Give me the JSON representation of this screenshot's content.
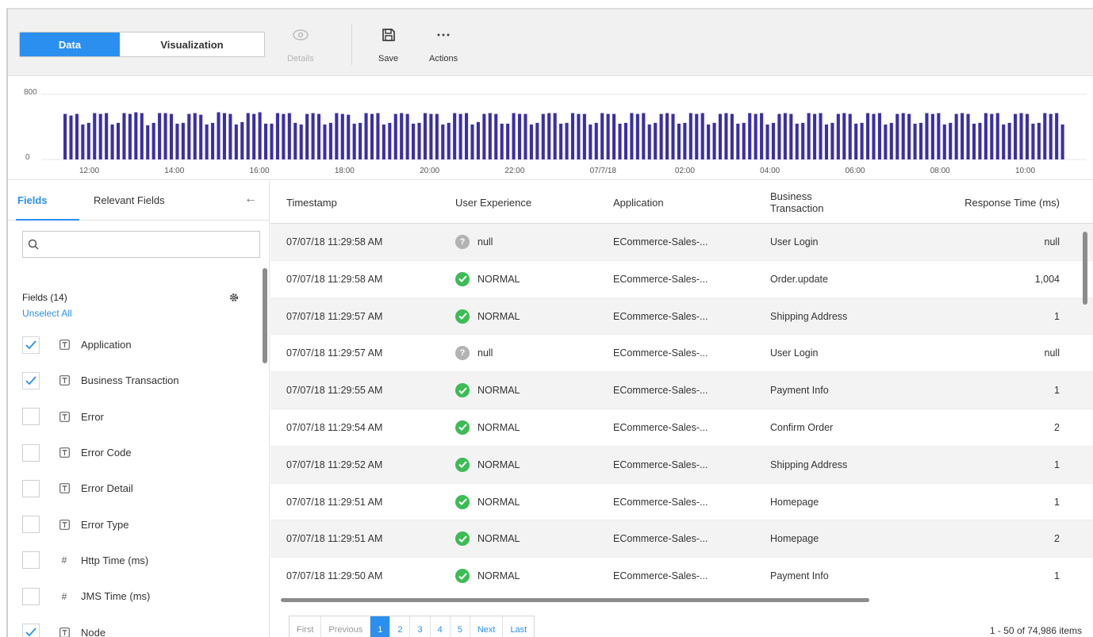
{
  "toolbar": {
    "tab_data": "Data",
    "tab_visualization": "Visualization",
    "details_label": "Details",
    "save_label": "Save",
    "actions_label": "Actions",
    "accent_color": "#2b8ff0"
  },
  "histogram": {
    "y_max_label": "800",
    "y_min_label": "0",
    "x_labels": [
      "12:00",
      "14:00",
      "16:00",
      "18:00",
      "20:00",
      "22:00",
      "07/7/18",
      "02:00",
      "04:00",
      "06:00",
      "08:00",
      "10:00"
    ],
    "bar_color": "#3a2fa8"
  },
  "chart_data": {
    "type": "bar",
    "ylim": [
      0,
      800
    ],
    "grid": true,
    "values": [
      560,
      540,
      560,
      430,
      450,
      570,
      560,
      570,
      430,
      450,
      570,
      560,
      580,
      570,
      420,
      450,
      570,
      570,
      560,
      440,
      450,
      560,
      570,
      550,
      430,
      450,
      580,
      570,
      560,
      430,
      460,
      570,
      560,
      580,
      440,
      440,
      570,
      560,
      570,
      450,
      430,
      560,
      570,
      560,
      430,
      450,
      570,
      560,
      550,
      440,
      450,
      570,
      560,
      570,
      430,
      450,
      560,
      570,
      560,
      440,
      450,
      570,
      560,
      560,
      430,
      450,
      570,
      560,
      570,
      430,
      460,
      560,
      570,
      560,
      440,
      440,
      570,
      560,
      560,
      430,
      450,
      560,
      570,
      570,
      440,
      450,
      570,
      560,
      560,
      430,
      450,
      570,
      560,
      560,
      440,
      450,
      570,
      560,
      570,
      430,
      450,
      560,
      570,
      560,
      440,
      450,
      570,
      560,
      570,
      430,
      450,
      560,
      570,
      560,
      440,
      450,
      570,
      560,
      570,
      430,
      450,
      560,
      570,
      560,
      440,
      450,
      570,
      560,
      570,
      430,
      450,
      560,
      570,
      560,
      440,
      450,
      570,
      560,
      570,
      430,
      450,
      560,
      570,
      560,
      440,
      450,
      570,
      560,
      570,
      430,
      450,
      560,
      570,
      560,
      440,
      450,
      570,
      560,
      570,
      430,
      450,
      560,
      570,
      560,
      440,
      450,
      570,
      560,
      570,
      430
    ]
  },
  "left_panel": {
    "tab_fields": "Fields",
    "tab_relevant": "Relevant Fields",
    "back_icon": "arrow-left-icon",
    "search_placeholder": "",
    "fields_count_label": "Fields (14)",
    "unselect_all": "Unselect All",
    "fields": [
      {
        "name": "Application",
        "type": "text",
        "checked": true
      },
      {
        "name": "Business Transaction",
        "type": "text",
        "checked": true
      },
      {
        "name": "Error",
        "type": "text",
        "checked": false
      },
      {
        "name": "Error Code",
        "type": "text",
        "checked": false
      },
      {
        "name": "Error Detail",
        "type": "text",
        "checked": false
      },
      {
        "name": "Error Type",
        "type": "text",
        "checked": false
      },
      {
        "name": "Http Time (ms)",
        "type": "number",
        "checked": false
      },
      {
        "name": "JMS Time (ms)",
        "type": "number",
        "checked": false
      },
      {
        "name": "Node",
        "type": "text",
        "checked": true
      }
    ]
  },
  "table": {
    "columns": [
      "Timestamp",
      "User Experience",
      "Application",
      "Business Transaction",
      "Response Time (ms)"
    ],
    "rows": [
      {
        "ts": "07/07/18 11:29:58 AM",
        "ux": "null",
        "ux_ok": false,
        "app": "ECommerce-Sales-...",
        "bt": "User Login",
        "rt": "null"
      },
      {
        "ts": "07/07/18 11:29:58 AM",
        "ux": "NORMAL",
        "ux_ok": true,
        "app": "ECommerce-Sales-...",
        "bt": "Order.update",
        "rt": "1,004"
      },
      {
        "ts": "07/07/18 11:29:57 AM",
        "ux": "NORMAL",
        "ux_ok": true,
        "app": "ECommerce-Sales-...",
        "bt": "Shipping Address",
        "rt": "1"
      },
      {
        "ts": "07/07/18 11:29:57 AM",
        "ux": "null",
        "ux_ok": false,
        "app": "ECommerce-Sales-...",
        "bt": "User Login",
        "rt": "null"
      },
      {
        "ts": "07/07/18 11:29:55 AM",
        "ux": "NORMAL",
        "ux_ok": true,
        "app": "ECommerce-Sales-...",
        "bt": "Payment Info",
        "rt": "1"
      },
      {
        "ts": "07/07/18 11:29:54 AM",
        "ux": "NORMAL",
        "ux_ok": true,
        "app": "ECommerce-Sales-...",
        "bt": "Confirm Order",
        "rt": "2"
      },
      {
        "ts": "07/07/18 11:29:52 AM",
        "ux": "NORMAL",
        "ux_ok": true,
        "app": "ECommerce-Sales-...",
        "bt": "Shipping Address",
        "rt": "1"
      },
      {
        "ts": "07/07/18 11:29:51 AM",
        "ux": "NORMAL",
        "ux_ok": true,
        "app": "ECommerce-Sales-...",
        "bt": "Homepage",
        "rt": "1"
      },
      {
        "ts": "07/07/18 11:29:51 AM",
        "ux": "NORMAL",
        "ux_ok": true,
        "app": "ECommerce-Sales-...",
        "bt": "Homepage",
        "rt": "2"
      },
      {
        "ts": "07/07/18 11:29:50 AM",
        "ux": "NORMAL",
        "ux_ok": true,
        "app": "ECommerce-Sales-...",
        "bt": "Payment Info",
        "rt": "1"
      }
    ],
    "status_ok_color": "#3dbb56",
    "status_unknown_color": "#b3b3b3"
  },
  "pagination": {
    "first": "First",
    "previous": "Previous",
    "pages": [
      "1",
      "2",
      "3",
      "4",
      "5"
    ],
    "current_page": "1",
    "next": "Next",
    "last": "Last",
    "items_label": "1 - 50 of 74,986 items"
  }
}
